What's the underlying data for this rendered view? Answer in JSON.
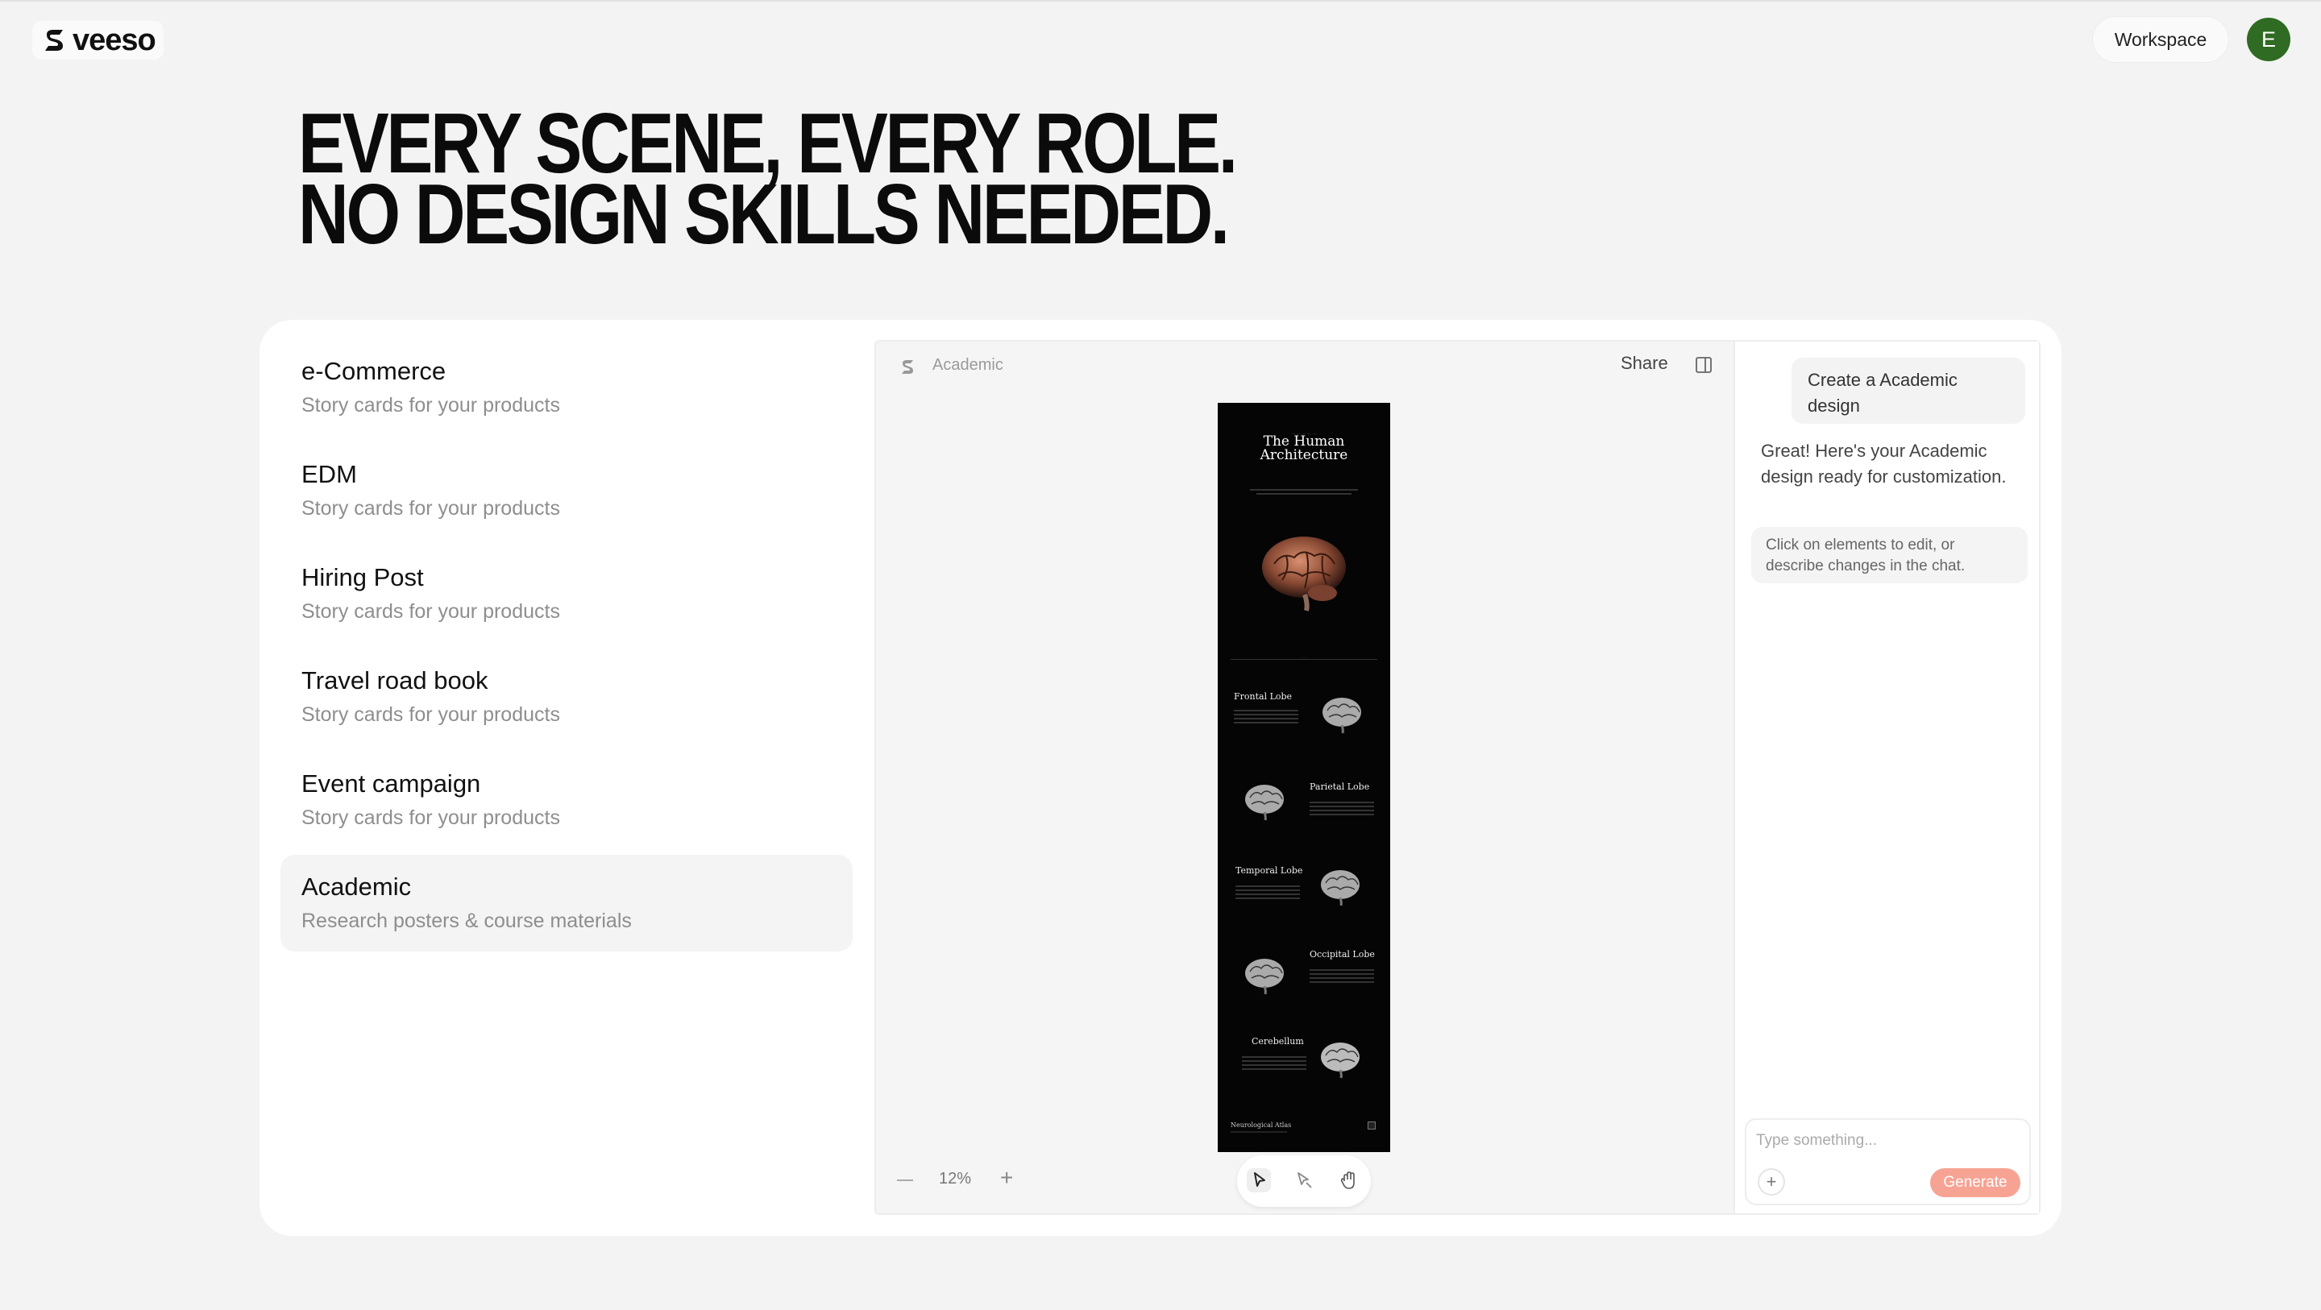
{
  "brand": {
    "name": "veeso"
  },
  "header": {
    "workspace_label": "Workspace",
    "avatar_initial": "E"
  },
  "hero": {
    "line1": "EVERY SCENE, EVERY ROLE.",
    "line2": "NO DESIGN SKILLS NEEDED."
  },
  "categories": [
    {
      "title": "e-Commerce",
      "subtitle": "Story cards for your products"
    },
    {
      "title": "EDM",
      "subtitle": "Story cards for your products"
    },
    {
      "title": "Hiring Post",
      "subtitle": "Story cards for your products"
    },
    {
      "title": "Travel road book",
      "subtitle": "Story cards for your products"
    },
    {
      "title": "Event campaign",
      "subtitle": "Story cards for your products"
    },
    {
      "title": "Academic",
      "subtitle": "Research posters & course materials"
    }
  ],
  "active_category": "Academic",
  "editor": {
    "doc_title": "Academic",
    "share_label": "Share",
    "zoom": "12%"
  },
  "poster": {
    "title_line1": "The Human",
    "title_line2": "Architecture",
    "sections": [
      {
        "title": "Frontal Lobe"
      },
      {
        "title": "Parietal Lobe"
      },
      {
        "title": "Temporal Lobe"
      },
      {
        "title": "Occipital Lobe"
      },
      {
        "title": "Cerebellum"
      }
    ],
    "footer": "Neurological Atlas"
  },
  "chat": {
    "user_message": "Create a Academic design",
    "assistant_message": "Great! Here's your Academic design ready for customization.",
    "tip": "Click on elements to edit, or describe changes in the chat.",
    "input_placeholder": "Type something...",
    "generate_label": "Generate",
    "attach_label": "+"
  },
  "colors": {
    "accent": "#f7a393",
    "avatar": "#2f6b22",
    "poster_bg": "#050505"
  },
  "icons": [
    "veeso-logo-icon",
    "panel-toggle-icon",
    "pointer-icon",
    "select-icon",
    "hand-icon",
    "minus-icon",
    "plus-icon",
    "brain-icon"
  ]
}
